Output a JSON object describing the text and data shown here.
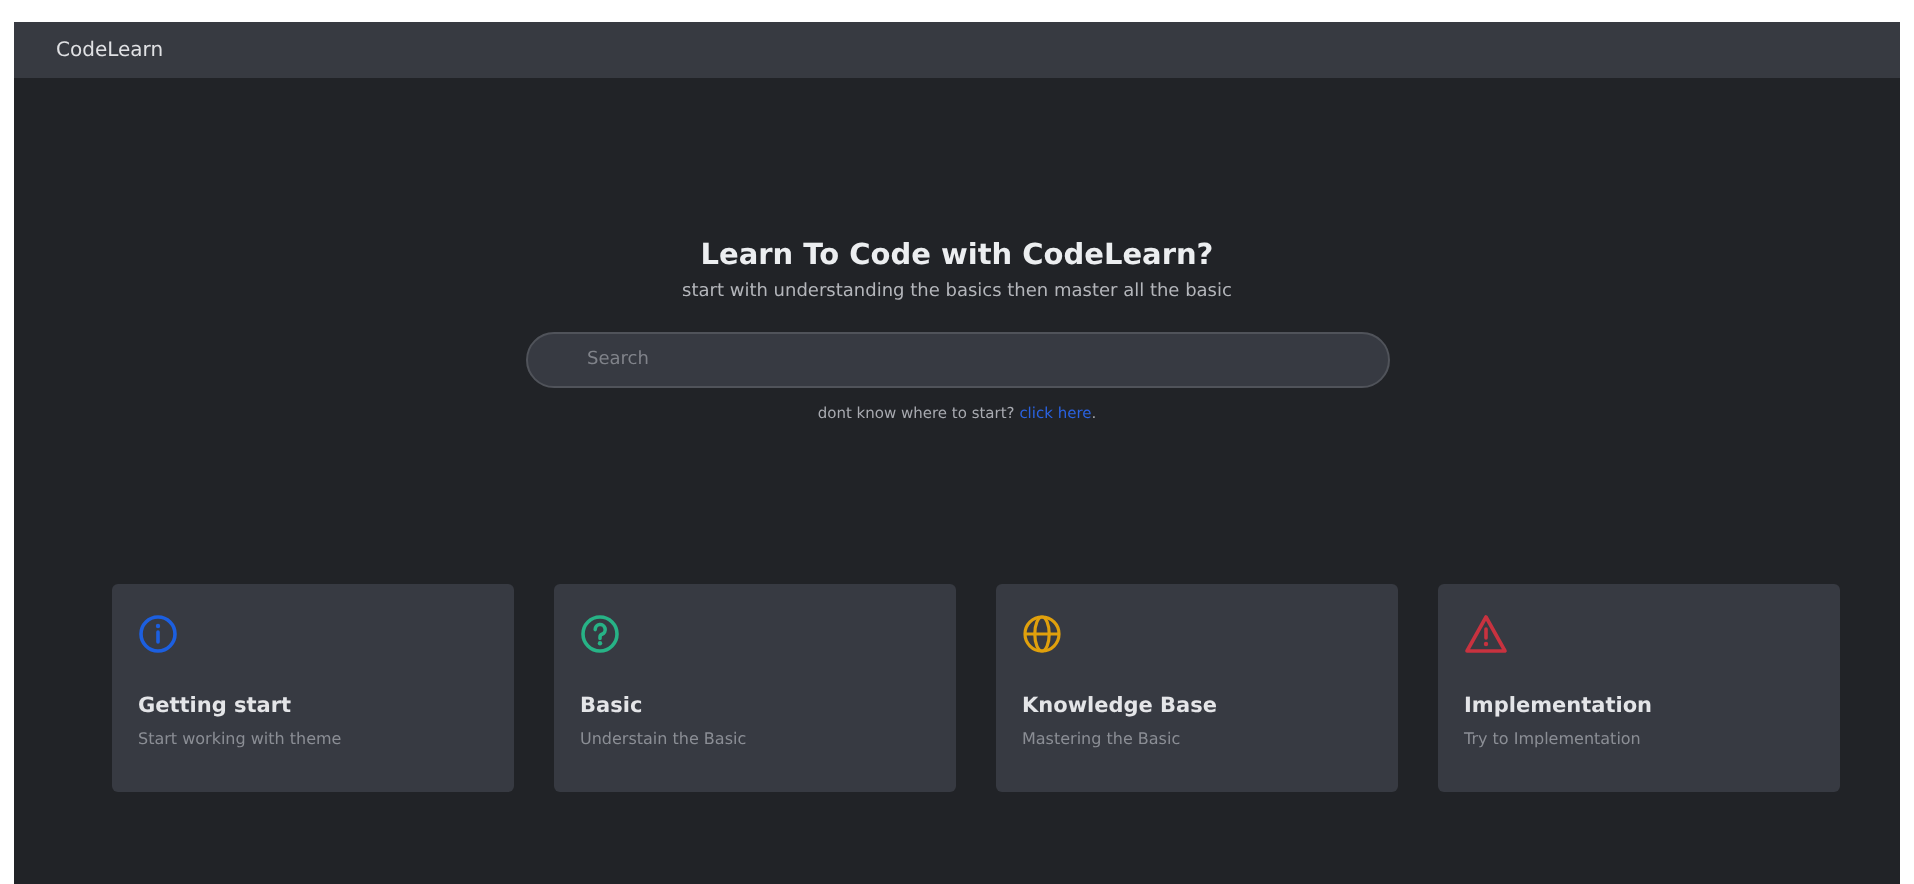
{
  "navbar": {
    "brand": "CodeLearn"
  },
  "hero": {
    "title": "Learn To Code with CodeLearn?",
    "subtitle": "start with understanding the basics then master all the basic",
    "search": {
      "placeholder": "Search"
    },
    "hint": {
      "text": "dont know where to start?",
      "link": "click here",
      "after": "."
    }
  },
  "cards": [
    {
      "kind": "info",
      "color": "#1c5fe0",
      "title": "Getting start",
      "description": "Start working with theme"
    },
    {
      "kind": "question",
      "color": "#27b386",
      "title": "Basic",
      "description": "Understain the Basic"
    },
    {
      "kind": "globe",
      "color": "#e0a00c",
      "title": "Knowledge Base",
      "description": "Mastering the Basic"
    },
    {
      "kind": "warning",
      "color": "#c8323f",
      "title": "Implementation",
      "description": "Try to Implementation"
    }
  ]
}
